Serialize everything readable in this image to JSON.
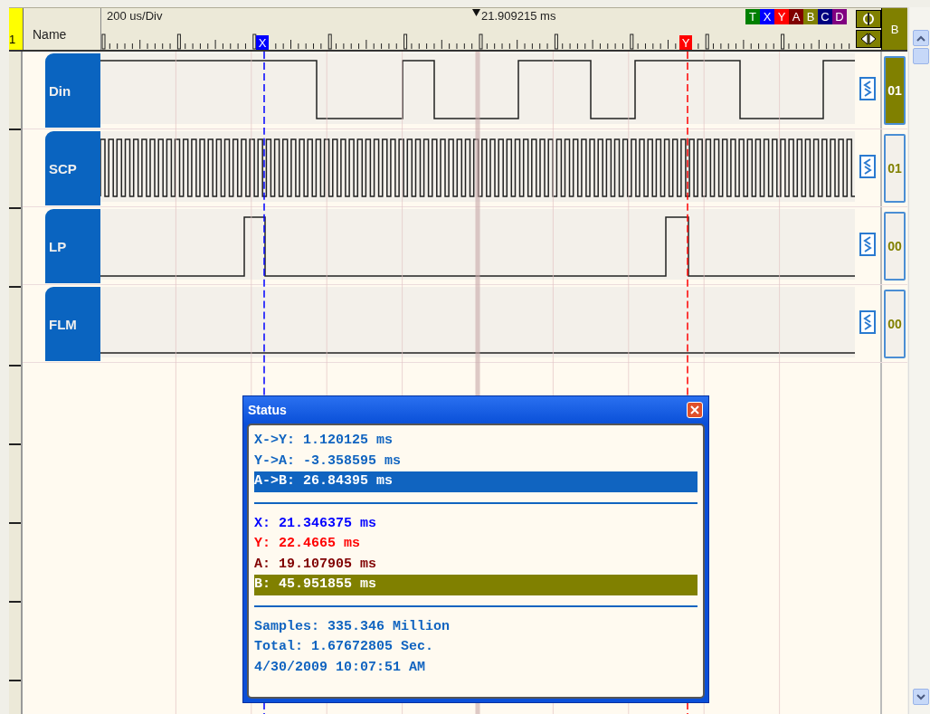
{
  "header": {
    "row_number": "1",
    "name_label": "Name",
    "time_scale": "200 us/Div",
    "trigger_time": "21.909215 ms",
    "value_label": "B"
  },
  "cursor_buttons": [
    {
      "label": "T",
      "color": "#008000"
    },
    {
      "label": "X",
      "color": "#0000ff"
    },
    {
      "label": "Y",
      "color": "#ff0000"
    },
    {
      "label": "A",
      "color": "#800000"
    },
    {
      "label": "B",
      "color": "#808000"
    },
    {
      "label": "C",
      "color": "#000080"
    },
    {
      "label": "D",
      "color": "#800080"
    }
  ],
  "ruler_cursors": [
    {
      "label": "X",
      "color": "#0000ff"
    },
    {
      "label": "Y",
      "color": "#ff0000"
    }
  ],
  "channels": [
    {
      "name": "Din",
      "value": "01",
      "selected": true
    },
    {
      "name": "SCP",
      "value": "01",
      "selected": false
    },
    {
      "name": "LP",
      "value": "00",
      "selected": false
    },
    {
      "name": "FLM",
      "value": "00",
      "selected": false
    }
  ],
  "status": {
    "title": "Status",
    "groups": [
      [
        {
          "text": "X->Y: 1.120125 ms",
          "color": "#1064c0",
          "selected": false
        },
        {
          "text": "Y->A: -3.358595 ms",
          "color": "#1064c0",
          "selected": false
        },
        {
          "text": "A->B: 26.84395 ms",
          "color": "#1064c0",
          "selected": true
        }
      ],
      [
        {
          "text": "X: 21.346375 ms",
          "color": "#0000ff",
          "selected": false
        },
        {
          "text": "Y: 22.4665 ms",
          "color": "#ff0000",
          "selected": false
        },
        {
          "text": "A: 19.107905 ms",
          "color": "#800000",
          "selected": false
        },
        {
          "text": "B: 45.951855 ms",
          "color": "#808000",
          "selected": true
        }
      ],
      [
        {
          "text": "Samples: 335.346 Million",
          "color": "#1064c0",
          "selected": false
        },
        {
          "text": "Total: 1.67672805 Sec.",
          "color": "#1064c0",
          "selected": false
        },
        {
          "text": "4/30/2009 10:07:51 AM",
          "color": "#1064c0",
          "selected": false
        }
      ]
    ]
  }
}
